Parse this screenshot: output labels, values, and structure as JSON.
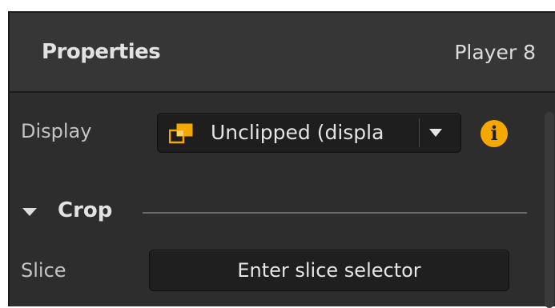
{
  "header": {
    "title": "Properties",
    "subtitle": "Player 8"
  },
  "display": {
    "label": "Display",
    "selected_value": "Unclipped (displa",
    "icon": "clip-overlap-icon",
    "accent_color": "#f5a800"
  },
  "info": {
    "icon": "info-icon",
    "glyph": "i",
    "color": "#f5a800"
  },
  "crop_section": {
    "title": "Crop",
    "collapsed": false
  },
  "slice": {
    "label": "Slice",
    "button_label": "Enter slice selector"
  }
}
